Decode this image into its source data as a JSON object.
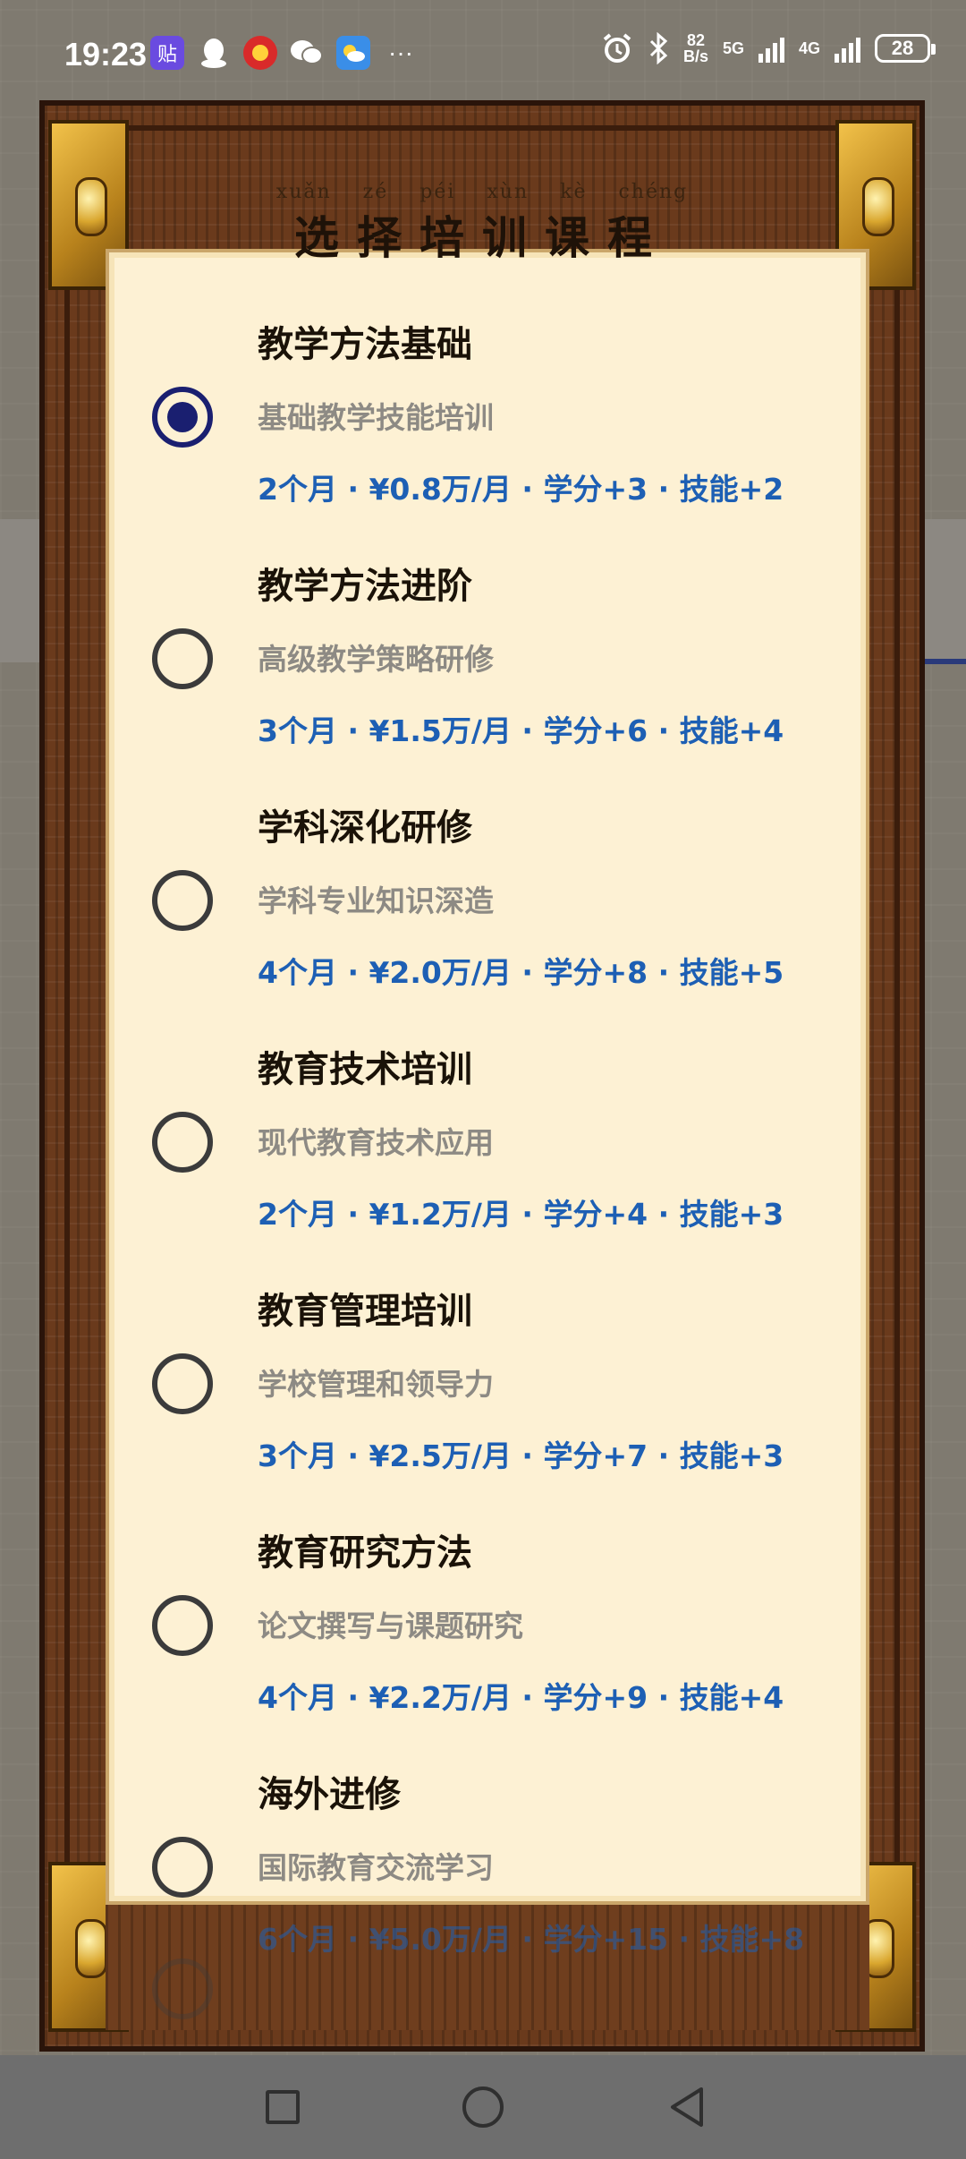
{
  "status_bar": {
    "time": "19:23",
    "app_icons": [
      "tieba-icon",
      "qq-icon",
      "game-icon",
      "wechat-icon",
      "weather-icon"
    ],
    "tieba_glyph": "贴",
    "more": "···",
    "net_speed_value": "82",
    "net_speed_unit": "B/s",
    "network_5g": "5G",
    "network_4g": "4G",
    "battery": "28"
  },
  "dialog": {
    "title_pinyin": "xuǎn zé péi xùn kè chéng",
    "title": "选择培训课程",
    "courses": [
      {
        "name": "教学方法基础",
        "desc": "基础教学技能培训",
        "meta": "2个月 · ¥0.8万/月 · 学分+3 · 技能+2",
        "selected": true
      },
      {
        "name": "教学方法进阶",
        "desc": "高级教学策略研修",
        "meta": "3个月 · ¥1.5万/月 · 学分+6 · 技能+4",
        "selected": false
      },
      {
        "name": "学科深化研修",
        "desc": "学科专业知识深造",
        "meta": "4个月 · ¥2.0万/月 · 学分+8 · 技能+5",
        "selected": false
      },
      {
        "name": "教育技术培训",
        "desc": "现代教育技术应用",
        "meta": "2个月 · ¥1.2万/月 · 学分+4 · 技能+3",
        "selected": false
      },
      {
        "name": "教育管理培训",
        "desc": "学校管理和领导力",
        "meta": "3个月 · ¥2.5万/月 · 学分+7 · 技能+3",
        "selected": false
      },
      {
        "name": "教育研究方法",
        "desc": "论文撰写与课题研究",
        "meta": "4个月 · ¥2.2万/月 · 学分+9 · 技能+4",
        "selected": false
      },
      {
        "name": "海外进修",
        "desc": "国际教育交流学习",
        "meta": "6个月 · ¥5.0万/月 · 学分+15 · 技能+8",
        "selected": false
      }
    ]
  },
  "nav_bar": {
    "buttons": [
      "recents-square-icon",
      "home-circle-icon",
      "back-triangle-icon"
    ]
  },
  "colors": {
    "accent_blue": "#1d5fb4",
    "radio_selected": "#1a1f70",
    "paper": "#fdf1d4",
    "wood": "#6a3a1c"
  }
}
